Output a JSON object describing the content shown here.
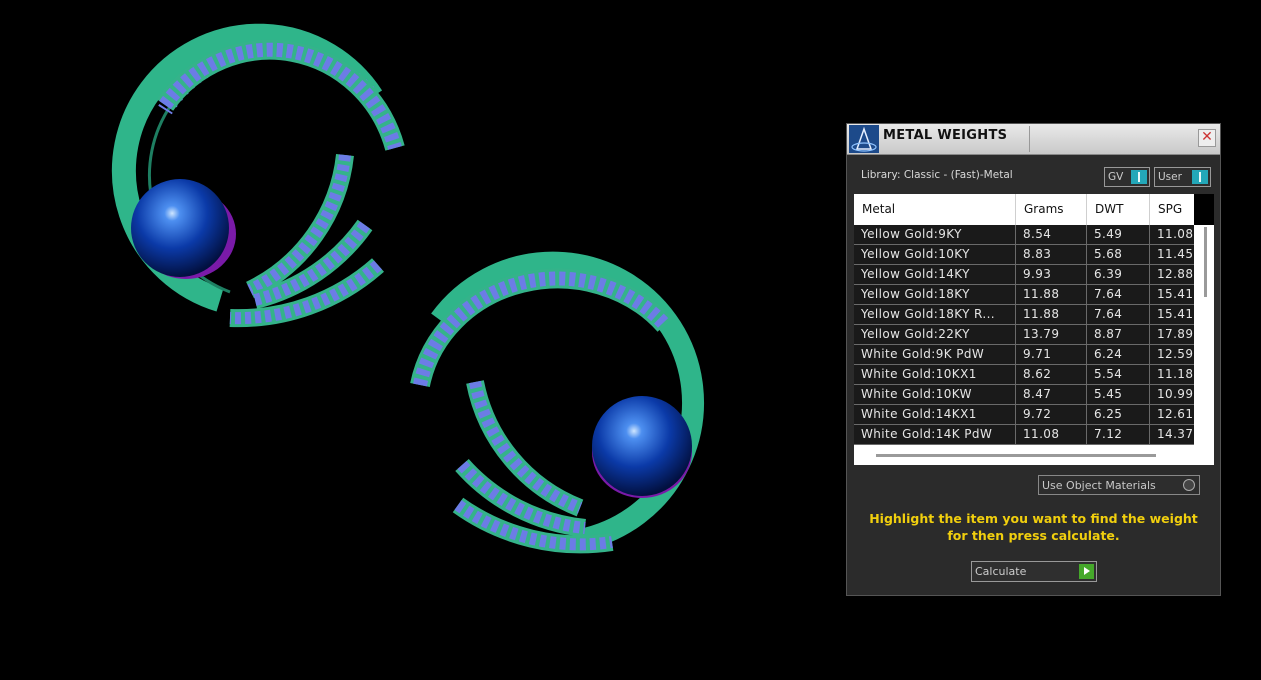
{
  "panel": {
    "title": "METAL WEIGHTS",
    "close_label": "✕",
    "library_label": "Library: Classic - (Fast)-Metal",
    "toggles": {
      "gv": "GV",
      "user": "User"
    },
    "table": {
      "headers": [
        "Metal",
        "Grams",
        "DWT",
        "SPG"
      ],
      "rows": [
        [
          "Yellow Gold:9KY",
          "8.54",
          "5.49",
          "11.08"
        ],
        [
          "Yellow Gold:10KY",
          "8.83",
          "5.68",
          "11.45"
        ],
        [
          "Yellow Gold:14KY",
          "9.93",
          "6.39",
          "12.88"
        ],
        [
          "Yellow Gold:18KY",
          "11.88",
          "7.64",
          "15.41"
        ],
        [
          "Yellow Gold:18KY R...",
          "11.88",
          "7.64",
          "15.41"
        ],
        [
          "Yellow Gold:22KY",
          "13.79",
          "8.87",
          "17.89"
        ],
        [
          "White Gold:9K PdW",
          "9.71",
          "6.24",
          "12.59"
        ],
        [
          "White Gold:10KX1",
          "8.62",
          "5.54",
          "11.18"
        ],
        [
          "White Gold:10KW",
          "8.47",
          "5.45",
          "10.99"
        ],
        [
          "White Gold:14KX1",
          "9.72",
          "6.25",
          "12.61"
        ],
        [
          "White Gold:14K PdW",
          "11.08",
          "7.12",
          "14.37"
        ]
      ]
    },
    "use_object_materials_label": "Use Object Materials",
    "instruction_line1": "Highlight the item you want to find the weight",
    "instruction_line2": "for then press calculate.",
    "calculate_label": "Calculate"
  },
  "colors": {
    "ring_metal": "#2fb58a",
    "gem": "#6f7ee8",
    "pearl": "#0b3aa8",
    "accent_toggle": "#23a7b8",
    "instruction_text": "#f1cf0e",
    "calculate_arrow": "#45a82a"
  },
  "icons": {
    "app_logo": "gemvision-logo-icon",
    "close": "close-icon",
    "calculate": "play-arrow-icon"
  }
}
